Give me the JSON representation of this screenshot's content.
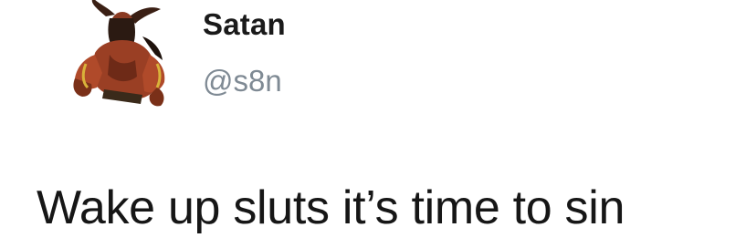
{
  "tweet": {
    "author": {
      "display_name": "Satan",
      "handle": "@s8n",
      "avatar_icon": "demon-avatar-icon"
    },
    "text": "Wake up sluts it’s time to sin"
  }
}
